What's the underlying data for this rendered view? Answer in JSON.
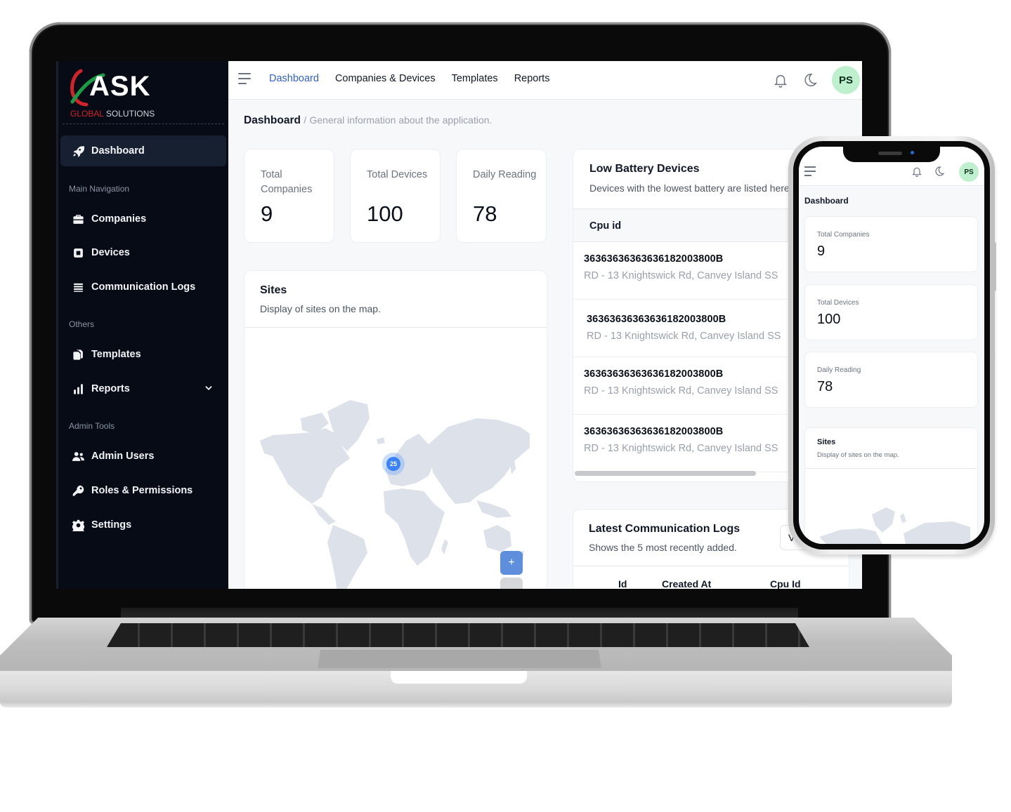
{
  "app": {
    "brand": {
      "name": "ASK",
      "tagline_red": "GLOBAL",
      "tagline_rest": " SOLUTIONS"
    },
    "colors": {
      "sidebar_bg": "#070b16",
      "active_nav": "#2f5fd0",
      "avatar_bg": "#bff0cd",
      "map_land": "#dde1ea",
      "cluster": "#3b82f6",
      "brand_red": "#d2232a",
      "brand_green": "#1a9b46"
    }
  },
  "sidebar": {
    "dashboard": {
      "label": "Dashboard",
      "icon": "rocket-icon"
    },
    "sections": [
      {
        "title": "Main Navigation",
        "items": [
          {
            "label": "Companies",
            "icon": "briefcase-icon"
          },
          {
            "label": "Devices",
            "icon": "chip-icon"
          },
          {
            "label": "Communication Logs",
            "icon": "list-icon"
          }
        ]
      },
      {
        "title": "Others",
        "items": [
          {
            "label": "Templates",
            "icon": "copy-icon"
          },
          {
            "label": "Reports",
            "icon": "bar-chart-icon",
            "has_submenu": true
          }
        ]
      },
      {
        "title": "Admin Tools",
        "items": [
          {
            "label": "Admin Users",
            "icon": "users-icon"
          },
          {
            "label": "Roles & Permissions",
            "icon": "key-icon"
          },
          {
            "label": "Settings",
            "icon": "gear-icon"
          }
        ]
      }
    ]
  },
  "topbar": {
    "nav": [
      {
        "label": "Dashboard",
        "active": true
      },
      {
        "label": "Companies & Devices",
        "active": false
      },
      {
        "label": "Templates",
        "active": false
      },
      {
        "label": "Reports",
        "active": false
      }
    ],
    "icons": [
      "bell-icon",
      "moon-icon"
    ],
    "avatar_initials": "PS"
  },
  "page": {
    "title": "Dashboard",
    "separator": "/",
    "description": "General information about the application."
  },
  "stats": [
    {
      "label": "Total Companies",
      "value": "9"
    },
    {
      "label": "Total Devices",
      "value": "100"
    },
    {
      "label": "Daily Reading",
      "value": "78"
    }
  ],
  "sites": {
    "title": "Sites",
    "subtitle": "Display of sites on the map.",
    "cluster_count": "25",
    "zoom_in_label": "+"
  },
  "low_battery": {
    "title": "Low Battery Devices",
    "subtitle": "Devices with the lowest battery are listed here",
    "column": "Cpu id",
    "rows": [
      {
        "cpu_id": "36363636363636182003800B",
        "address": "RD - 13 Knightswick Rd, Canvey Island SS"
      },
      {
        "cpu_id": "36363636363636182003800B",
        "address": "RD - 13 Knightswick Rd, Canvey Island SS"
      },
      {
        "cpu_id": "36363636363636182003800B",
        "address": "RD - 13 Knightswick Rd, Canvey Island SS"
      },
      {
        "cpu_id": "36363636363636182003800B",
        "address": "RD - 13 Knightswick Rd, Canvey Island SS"
      }
    ]
  },
  "comm_logs": {
    "title": "Latest Communication Logs",
    "subtitle": "Shows the 5 most recently added.",
    "view_button": "V",
    "columns": [
      "Id",
      "Created At",
      "Cpu Id"
    ]
  },
  "phone": {
    "page_title": "Dashboard",
    "avatar_initials": "PS",
    "stats": [
      {
        "label": "Total Companies",
        "value": "9"
      },
      {
        "label": "Total Devices",
        "value": "100"
      },
      {
        "label": "Daily Reading",
        "value": "78"
      }
    ],
    "sites_title": "Sites",
    "sites_subtitle": "Display of sites on the map."
  }
}
